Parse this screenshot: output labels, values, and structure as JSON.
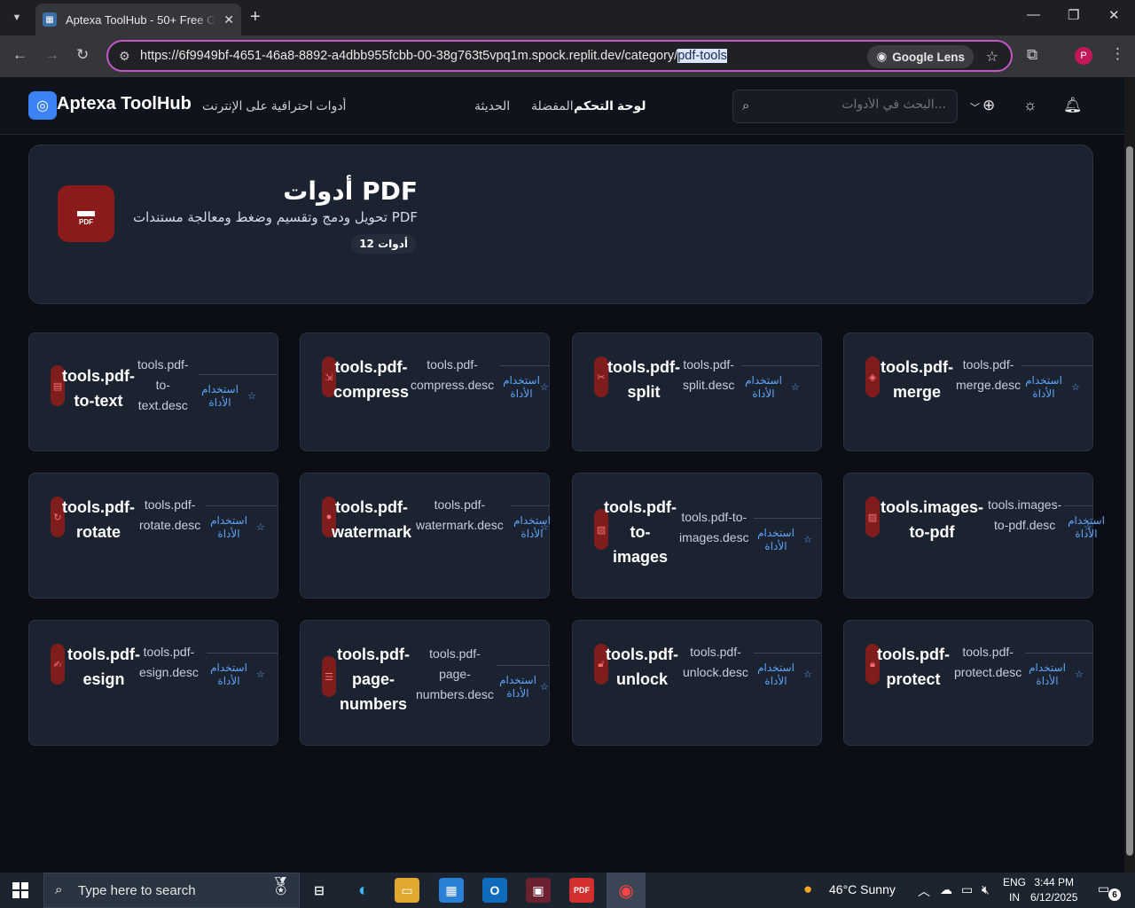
{
  "browser": {
    "tab_title": "Aptexa ToolHub - 50+ Free Onl",
    "url_main": "https://6f9949bf-4651-46a8-8892-a4dbb955fcbb-00-38g763t5vpq1m.spock.replit.dev/category/",
    "url_selected": "pdf-tools",
    "lens_label": "Google Lens",
    "profile_initial": "P"
  },
  "header": {
    "brand": "Aptexa ToolHub",
    "tagline": "أدوات احترافية على الإنترنت",
    "nav": [
      "الحديثة",
      "المفضلة",
      "لوحة التحكم"
    ],
    "search_placeholder": "البحث في الأدوات..."
  },
  "hero": {
    "icon_label": "PDF",
    "title": "أدوات PDF",
    "subtitle": "تحويل ودمج وتقسيم وضغط ومعالجة مستندات PDF",
    "count_badge": "12 أدوات"
  },
  "tools": [
    {
      "name": "tools.pdf-to-text",
      "desc": "tools.pdf-to-text.desc",
      "icon": "file-text-icon",
      "use": "استخدام الأداة",
      "fav_icon": "star-icon"
    },
    {
      "name": "tools.pdf-compress",
      "desc": "tools.pdf-compress.desc",
      "icon": "compress-icon",
      "use": "استخدام الأداة",
      "fav_icon": "star-icon"
    },
    {
      "name": "tools.pdf-split",
      "desc": "tools.pdf-split.desc",
      "icon": "scissors-icon",
      "use": "استخدام الأداة",
      "fav_icon": "star-icon"
    },
    {
      "name": "tools.pdf-merge",
      "desc": "tools.pdf-merge.desc",
      "icon": "layers-icon",
      "use": "استخدام الأداة",
      "fav_icon": "star-icon"
    },
    {
      "name": "tools.pdf-rotate",
      "desc": "tools.pdf-rotate.desc",
      "icon": "rotate-icon",
      "use": "استخدام الأداة",
      "fav_icon": "star-icon"
    },
    {
      "name": "tools.pdf-watermark",
      "desc": "tools.pdf-watermark.desc",
      "icon": "droplet-icon",
      "use": "استخدام الأداة",
      "fav_icon": "star-icon"
    },
    {
      "name": "tools.pdf-to-images",
      "desc": "tools.pdf-to-images.desc",
      "icon": "file-image-icon",
      "use": "استخدام الأداة",
      "fav_icon": "star-icon"
    },
    {
      "name": "tools.images-to-pdf",
      "desc": "tools.images-to-pdf.desc",
      "icon": "images-icon",
      "use": "استخدام الأداة",
      "fav_icon": "star-icon"
    },
    {
      "name": "tools.pdf-esign",
      "desc": "tools.pdf-esign.desc",
      "icon": "signature-icon",
      "use": "استخدام الأداة",
      "fav_icon": "star-icon"
    },
    {
      "name": "tools.pdf-page-numbers",
      "desc": "tools.pdf-page-numbers.desc",
      "icon": "list-ordered-icon",
      "use": "استخدام الأداة",
      "fav_icon": "star-icon"
    },
    {
      "name": "tools.pdf-unlock",
      "desc": "tools.pdf-unlock.desc",
      "icon": "unlock-icon",
      "use": "استخدام الأداة",
      "fav_icon": "star-icon"
    },
    {
      "name": "tools.pdf-protect",
      "desc": "tools.pdf-protect.desc",
      "icon": "lock-icon",
      "use": "استخدام الأداة",
      "fav_icon": "star-icon"
    }
  ],
  "taskbar": {
    "search_placeholder": "Type here to search",
    "weather": "46°C  Sunny",
    "lang_1": "ENG",
    "lang_2": "IN",
    "time": "3:44 PM",
    "date": "6/12/2025",
    "notif_count": "6"
  },
  "colors": {
    "accent": "#3b82f6",
    "pdf_red": "#8b1a1a",
    "link_blue": "#60a5fa",
    "card_bg": "#1b2230",
    "page_bg": "#0b0e14"
  }
}
